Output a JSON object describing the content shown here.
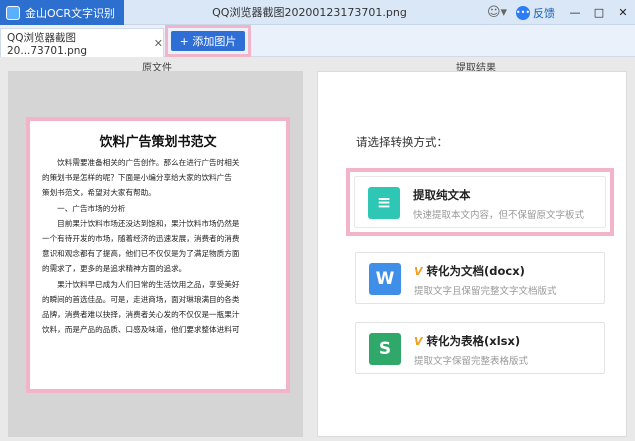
{
  "app": {
    "name": "金山OCR文字识别",
    "window_title": "QQ浏览器截图20200123173701.png",
    "feedback_label": "反馈",
    "window_controls": {
      "minimize": "—",
      "maximize": "□",
      "close": "✕"
    }
  },
  "tabs": [
    {
      "label": "QQ浏览器截图20...73701.png",
      "close": "✕"
    }
  ],
  "toolbar": {
    "add_image_label": "+ 添加图片"
  },
  "panes": {
    "original_label": "原文件",
    "result_label": "提取结果"
  },
  "document": {
    "title": "饮料广告策划书范文",
    "lines": [
      "　　饮料需要准备相关的广告创作。那么在进行广告时相关",
      "的策划书是怎样的呢？下面是小编分享给大家的饮料广告",
      "策划书范文，希望对大家有帮助。",
      "　　一、广告市场的分析",
      "　　目前果汁饮料市场还没达到饱和，果汁饮料市场仍然是",
      "一个有待开发的市场，随着经济的迅速发展，消费者的消费",
      "意识和观念都有了提高，他们已不仅仅是为了满足物质方面",
      "的需求了，更多的是追求精神方面的追求。",
      "　　果汁饮料早已成为人们日常的生活饮用之品，享受美好",
      "的瞬间的首选佳品。可是，走进商场，面对琳琅满目的各类",
      "品牌，消费者难以抉择，消费者关心发的不仅仅是一瓶果汁",
      "饮料，而是产品的品质、口感及味道，他们要求整体进料可"
    ]
  },
  "result": {
    "prompt": "请选择转换方式：",
    "options": [
      {
        "title": "提取纯文本",
        "desc": "快速提取本文内容，但不保留原文字板式",
        "icon": "text-lines-icon",
        "color": "#2ec6b5",
        "glyph": "≡",
        "vip": false
      },
      {
        "title": "转化为文档(docx)",
        "desc": "提取文字且保留完整文字文档版式",
        "icon": "word-doc-icon",
        "color": "#3f8fe8",
        "glyph": "W",
        "vip": true
      },
      {
        "title": "转化为表格(xlsx)",
        "desc": "提取文字保留完整表格版式",
        "icon": "excel-sheet-icon",
        "color": "#2fa86a",
        "glyph": "S",
        "vip": true
      }
    ],
    "vip_mark": "V"
  }
}
